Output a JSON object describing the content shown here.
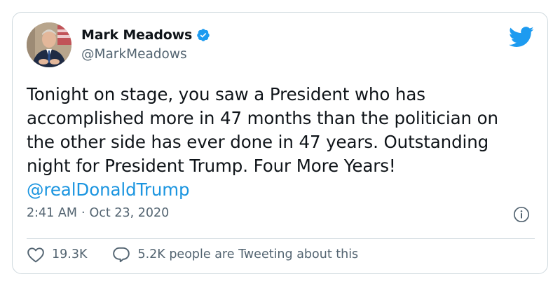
{
  "author": {
    "display_name": "Mark Meadows",
    "handle": "@MarkMeadows",
    "verified": true
  },
  "tweet": {
    "text": "Tonight on stage, you saw a President who has accomplished more in 47 months than the politician on the other side has ever done in 47 years. Outstanding night for President Trump. Four More Years!",
    "mention": "@realDonaldTrump",
    "time": "2:41 AM",
    "separator": "·",
    "date": "Oct 23, 2020"
  },
  "actions": {
    "likes": "19.3K",
    "reply_label": "5.2K people are Tweeting about this"
  },
  "icons": {
    "brand": "twitter-bird-icon",
    "verified": "verified-badge-icon",
    "info": "info-icon",
    "like": "heart-icon",
    "reply": "speech-bubble-icon"
  },
  "colors": {
    "brand_blue": "#1d9bf0",
    "mention_blue": "#1b95e0",
    "text_primary": "#0f1419",
    "text_secondary": "#536471",
    "border": "#cfd9de"
  }
}
